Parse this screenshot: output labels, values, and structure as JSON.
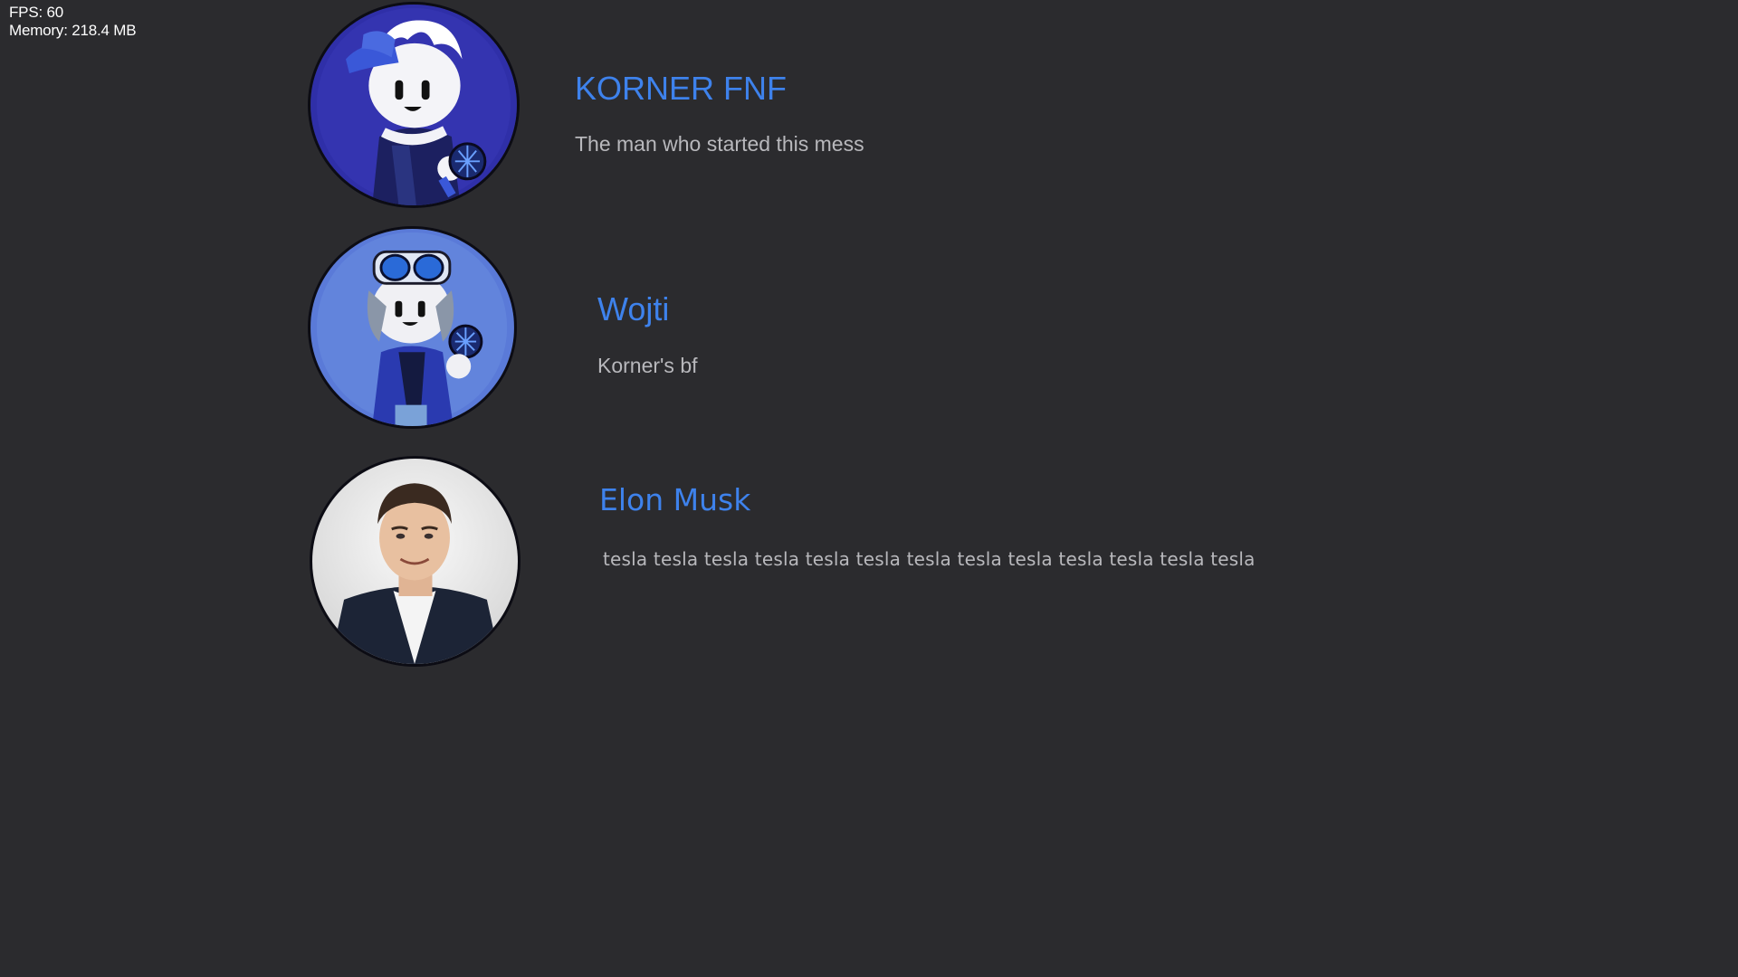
{
  "debug": {
    "fps": "FPS: 60",
    "memory": "Memory: 218.4 MB"
  },
  "credits": [
    {
      "name": "KORNER FNF",
      "description": "The man who started this mess",
      "avatar_icon": "korner-character-icon"
    },
    {
      "name": "Wojti",
      "description": "Korner's bf",
      "avatar_icon": "wojti-character-icon"
    },
    {
      "name": "Elon Musk",
      "description": "tesla tesla tesla tesla tesla tesla tesla tesla tesla tesla tesla tesla tesla",
      "avatar_icon": "elon-musk-photo-icon"
    }
  ],
  "colors": {
    "background": "#2b2b2e",
    "name_text": "#3e82ec",
    "description_text": "#b8b8bc",
    "debug_text": "#ffffff"
  }
}
